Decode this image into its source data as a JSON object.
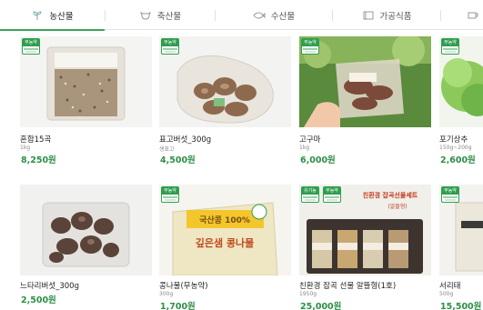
{
  "tabs": [
    {
      "label": "농산물",
      "icon": "sprout-icon",
      "active": true
    },
    {
      "label": "축산물",
      "icon": "cow-icon",
      "active": false
    },
    {
      "label": "수산물",
      "icon": "fish-icon",
      "active": false
    },
    {
      "label": "가공식품",
      "icon": "box-icon",
      "active": false
    },
    {
      "label": "",
      "icon": "cup-icon",
      "active": false
    }
  ],
  "badge_text": "무농약",
  "badge_text_alt": "유기농",
  "products": [
    {
      "name": "혼합15곡",
      "desc": "1kg",
      "price": "8,250원"
    },
    {
      "name": "표고버섯_300g",
      "desc": "생표고",
      "price": "4,500원"
    },
    {
      "name": "고구마",
      "desc": "1kg",
      "price": "6,000원"
    },
    {
      "name": "포기상추",
      "desc": "150g~200g",
      "price": "2,600원"
    },
    {
      "name": "느타리버섯_300g",
      "desc": "",
      "price": "2,500원"
    },
    {
      "name": "콩나물(무농약)",
      "desc": "300g",
      "price": "1,700원"
    },
    {
      "name": "친환경 잡곡 선물 알뜰형(1호)",
      "desc": "1950g",
      "price": "25,000원"
    },
    {
      "name": "서리태",
      "desc": "500g",
      "price": "15,500원"
    }
  ],
  "package_text": {
    "bag_label": "국산콩 100%",
    "bag_name": "깊은샘 콩나물",
    "gift_title": "친환경 잡곡선물세트",
    "gift_sub": "(알뜰형)"
  },
  "colors": {
    "accent": "#3aa35a",
    "price": "#2d8f46",
    "badge": "#2f9e4f"
  }
}
